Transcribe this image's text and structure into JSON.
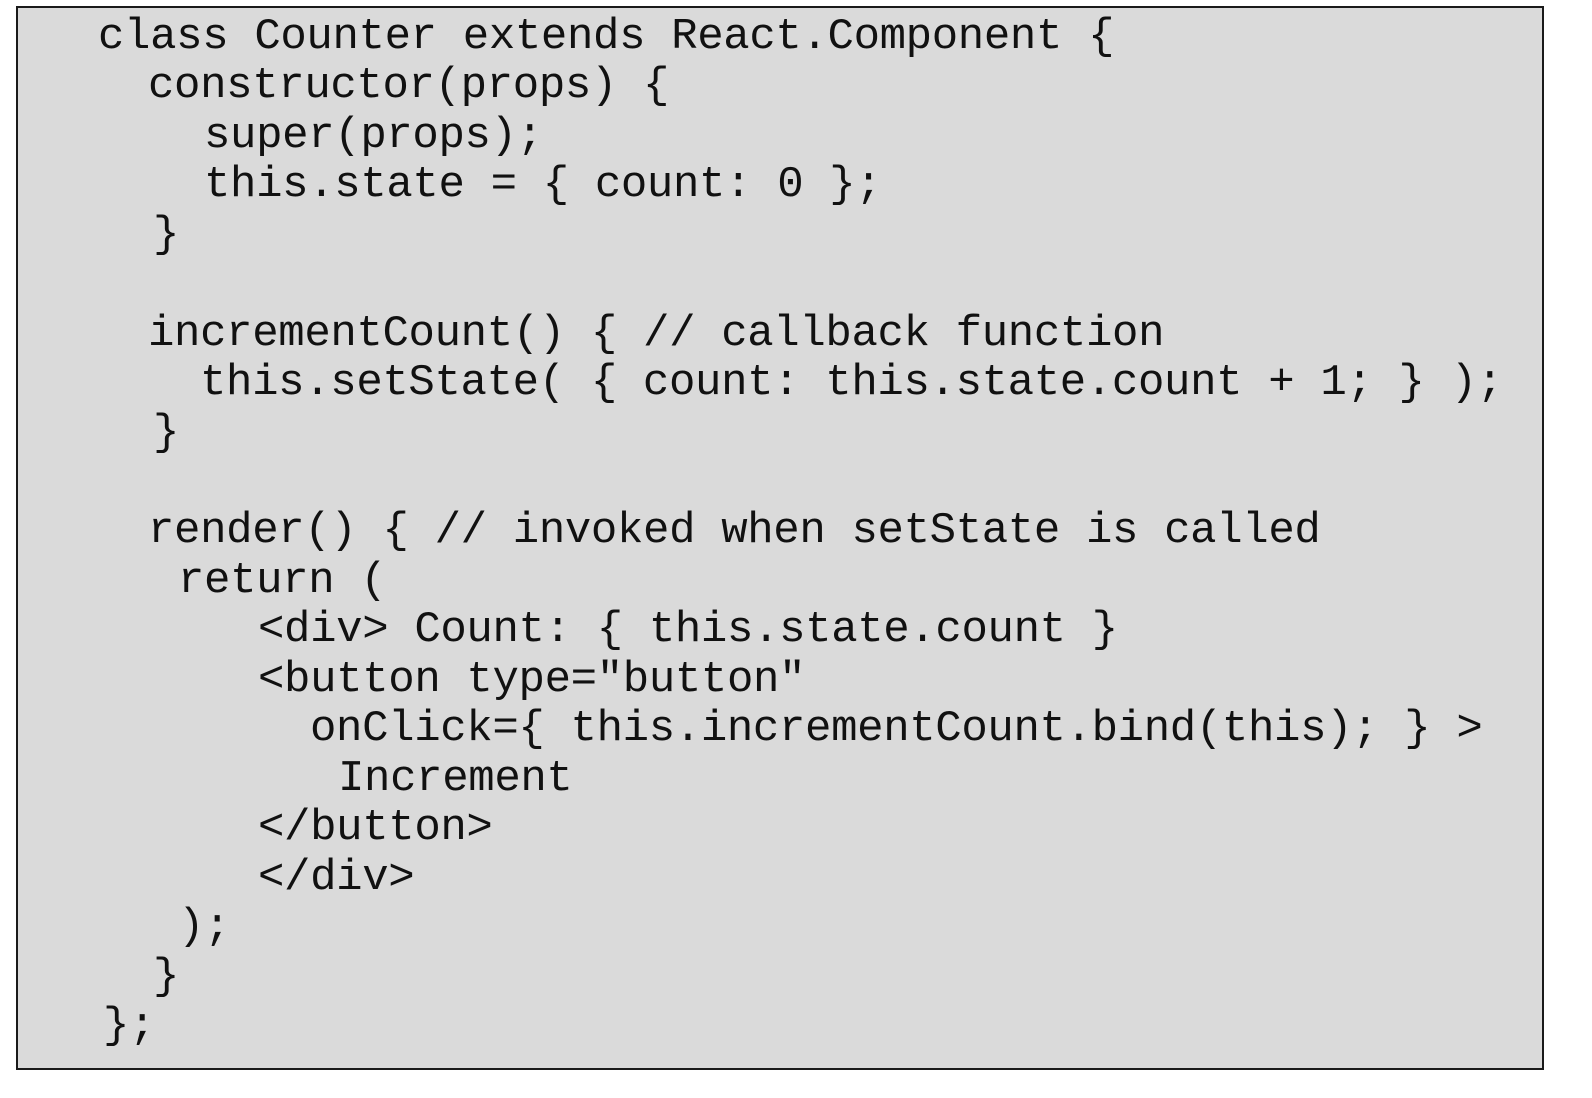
{
  "code": {
    "lines": [
      "class Counter extends React.Component {",
      "constructor(props) {",
      "super(props);",
      "this.state = { count: 0 };",
      "}",
      "",
      "incrementCount() { // callback function",
      "this.setState( { count: this.state.count + 1; } );",
      "}",
      "",
      "render() { // invoked when setState is called",
      "return (",
      "<div> Count: { this.state.count }",
      "<button type=\"button\"",
      "onClick={ this.incrementCount.bind(this); } >",
      "Increment",
      "</button>",
      "</div>",
      ");",
      "}",
      "};"
    ]
  },
  "colors": {
    "background": "#dadada",
    "border": "#1a1a1a",
    "text": "#111111"
  }
}
